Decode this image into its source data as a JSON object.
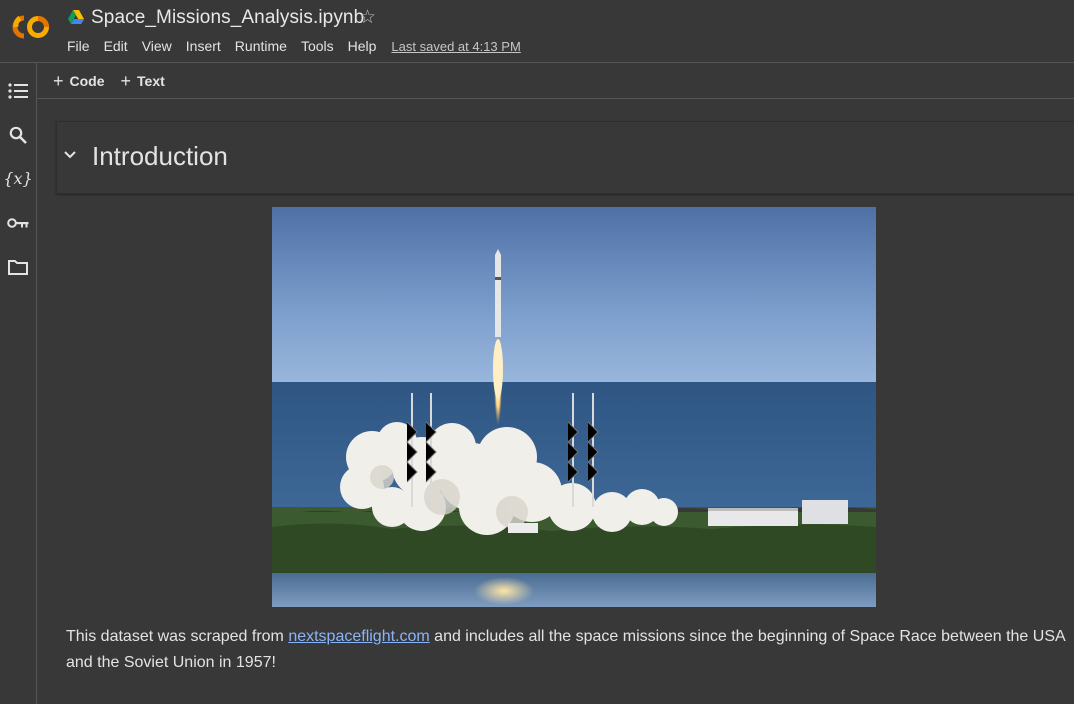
{
  "app": {
    "logo_text": "CO"
  },
  "header": {
    "title": "Space_Missions_Analysis.ipynb",
    "star": "☆",
    "menu": [
      "File",
      "Edit",
      "View",
      "Insert",
      "Runtime",
      "Tools",
      "Help"
    ],
    "last_saved": "Last saved at 4:13 PM"
  },
  "rail": {
    "items": [
      "table-of-contents-icon",
      "search-icon",
      "variables-icon",
      "key-icon",
      "folder-icon"
    ],
    "variables_glyph": "{x}"
  },
  "toolbar": {
    "code_label": "Code",
    "text_label": "Text",
    "plus": "+"
  },
  "notebook": {
    "section_title": "Introduction",
    "image_alt": "Rocket launch",
    "para_before": "This dataset was scraped from ",
    "link_text": "nextspaceflight.com",
    "para_after": " and includes all the space missions since the beginning of Space Race between the USA and the Soviet Union in 1957!"
  },
  "colors": {
    "background": "#383838",
    "link": "#8ab4f8",
    "logo_orange": "#f9ab00",
    "logo_dark_orange": "#e37400"
  }
}
